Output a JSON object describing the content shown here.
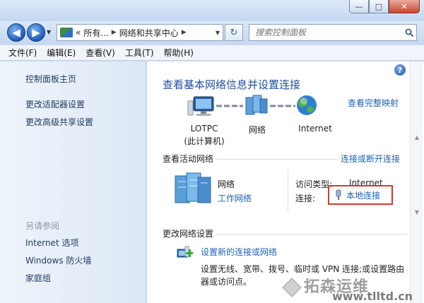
{
  "window": {
    "controls": {
      "minimize": "—",
      "maximize": "□",
      "close": "✕"
    }
  },
  "nav": {
    "back_icon": "◀",
    "forward_icon": "▶",
    "dropdown_icon": "▼",
    "address": {
      "chevrons": "«",
      "segment1": "所有...",
      "segment2": "网络和共享中心",
      "separator": "▶"
    },
    "refresh_icon": "↻",
    "search_placeholder": "搜索控制面板"
  },
  "menubar": {
    "items": [
      "文件(F)",
      "编辑(E)",
      "查看(V)",
      "工具(T)",
      "帮助(H)"
    ]
  },
  "sidebar": {
    "links": [
      "控制面板主页",
      "更改适配器设置",
      "更改高级共享设置"
    ],
    "see_also_heading": "另请参阅",
    "see_also": [
      "Internet 选项",
      "Windows 防火墙",
      "家庭组"
    ]
  },
  "main": {
    "help_icon": "?",
    "title": "查看基本网络信息并设置连接",
    "view_full_map": "查看完整映射",
    "map": {
      "computer_name": "LOTPC",
      "computer_sub": "(此计算机)",
      "network": "网络",
      "internet": "Internet"
    },
    "active_networks": {
      "heading": "查看活动网络",
      "connect_disconnect": "连接或断开连接",
      "network_name": "网络",
      "network_type": "工作网络",
      "access_type_label": "访问类型:",
      "access_type_value": "Internet",
      "connections_label": "连接:",
      "connection_name": "本地连接"
    },
    "change_settings": {
      "heading": "更改网络设置",
      "task_title": "设置新的连接或网络",
      "task_desc": "设置无线、宽带、拨号、临时或 VPN 连接;或设置路由器或访问点。"
    }
  },
  "watermark": {
    "text": "拓森运维",
    "url": "www.tlltd.cn"
  }
}
